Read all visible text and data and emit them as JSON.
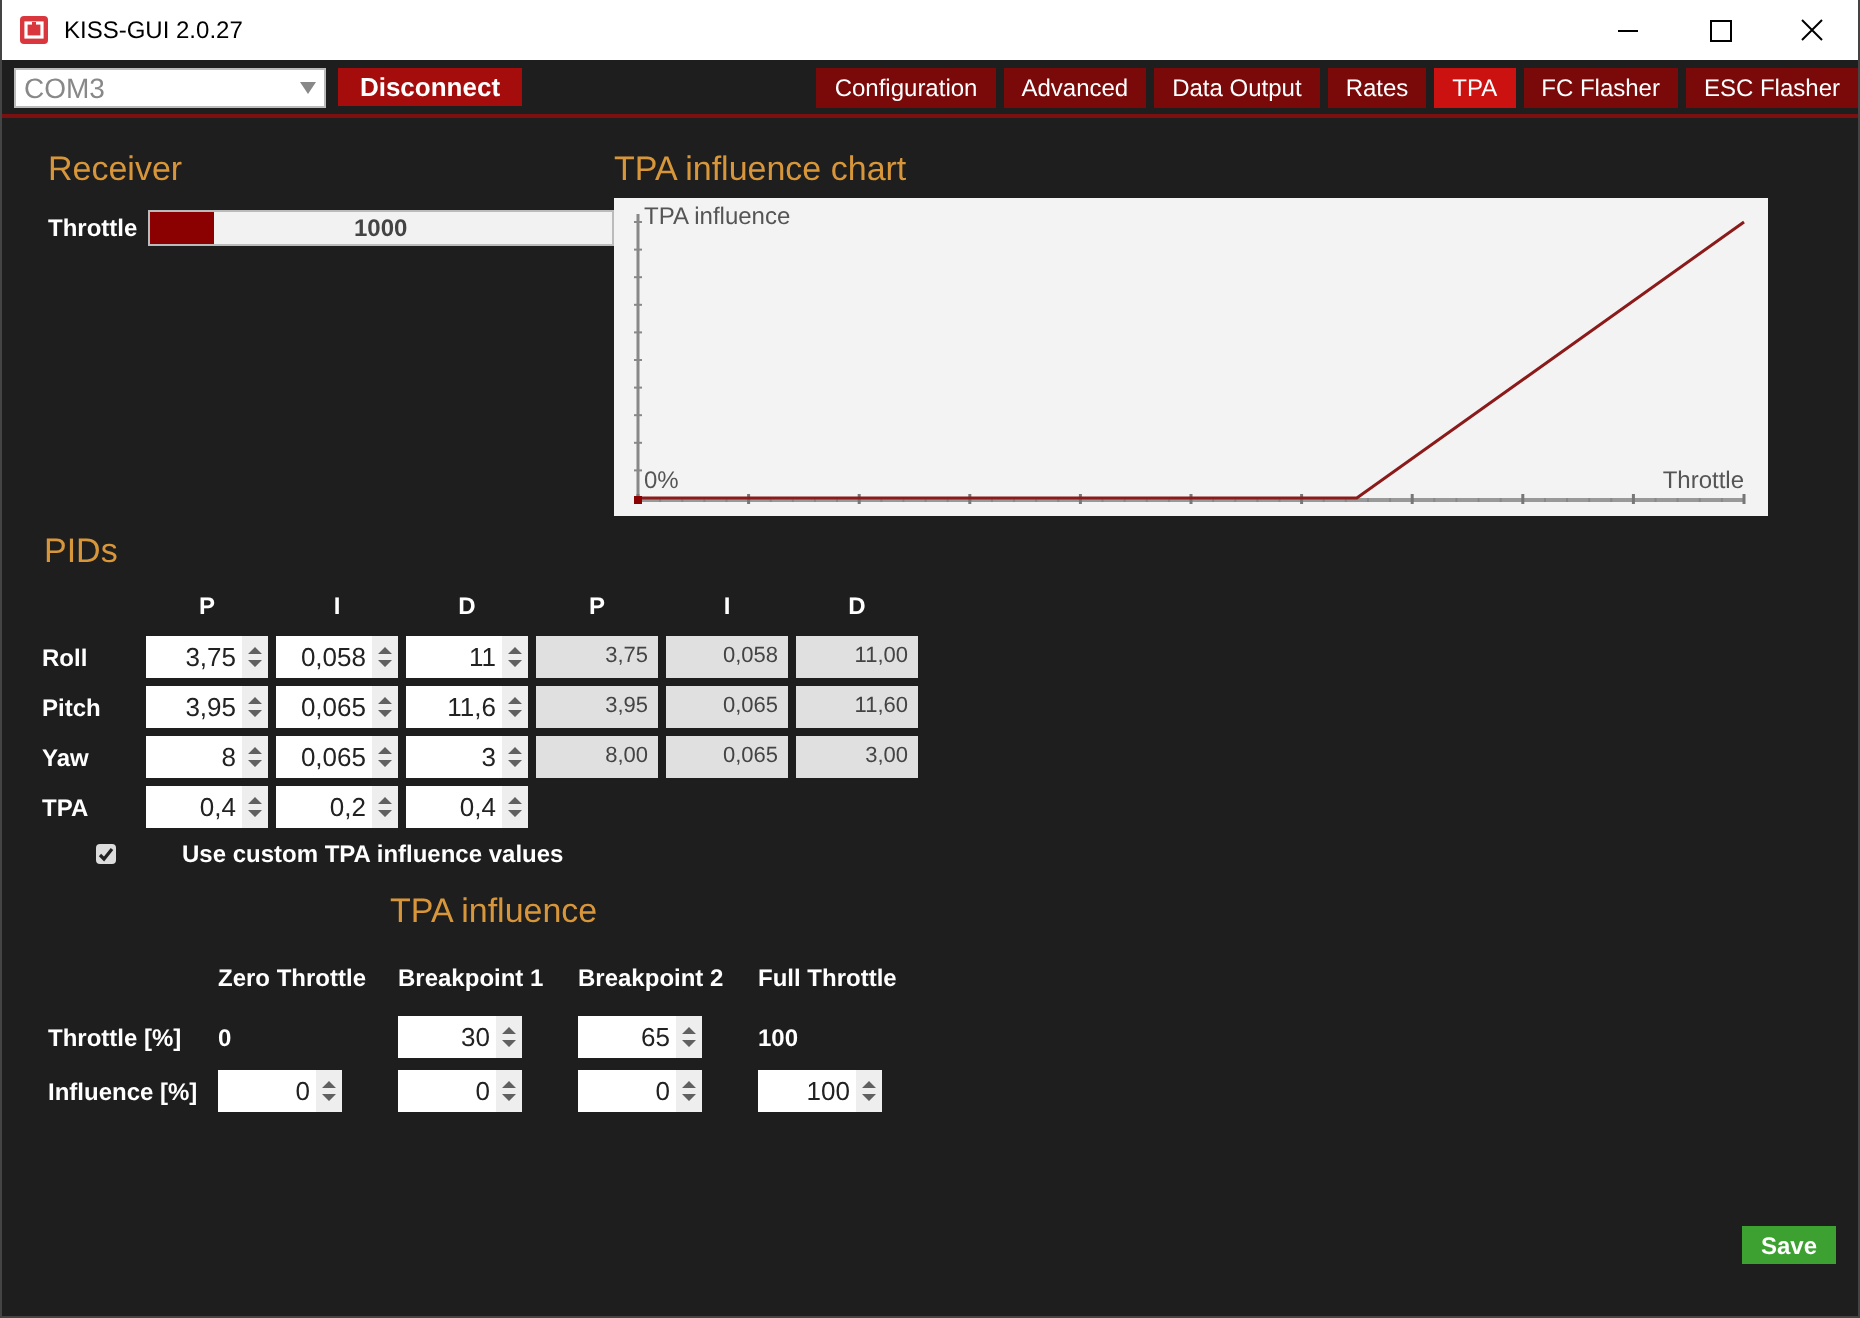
{
  "window": {
    "title": "KISS-GUI 2.0.27"
  },
  "port_select": {
    "value": "COM3"
  },
  "connect_button": "Disconnect",
  "tabs": [
    {
      "label": "Configuration",
      "selected": false
    },
    {
      "label": "Advanced",
      "selected": false
    },
    {
      "label": "Data Output",
      "selected": false
    },
    {
      "label": "Rates",
      "selected": false
    },
    {
      "label": "TPA",
      "selected": true
    },
    {
      "label": "FC Flasher",
      "selected": false
    },
    {
      "label": "ESC Flasher",
      "selected": false
    }
  ],
  "receiver": {
    "title": "Receiver",
    "channels": [
      {
        "label": "Throttle",
        "value": "1000",
        "level": 0.14
      }
    ]
  },
  "chart": {
    "title": "TPA influence chart",
    "ylabel": "TPA influence",
    "origin_label": "0%",
    "xlabel": "Throttle"
  },
  "pids": {
    "title": "PIDs",
    "columns": [
      "P",
      "I",
      "D",
      "P",
      "I",
      "D"
    ],
    "rows": [
      {
        "label": "Roll",
        "inputs": [
          "3,75",
          "0,058",
          "11"
        ],
        "rates": [
          "3,75",
          "0,058",
          "11,00"
        ]
      },
      {
        "label": "Pitch",
        "inputs": [
          "3,95",
          "0,065",
          "11,6"
        ],
        "rates": [
          "3,95",
          "0,065",
          "11,60"
        ]
      },
      {
        "label": "Yaw",
        "inputs": [
          "8",
          "0,065",
          "3"
        ],
        "rates": [
          "8,00",
          "0,065",
          "3,00"
        ]
      },
      {
        "label": "TPA",
        "inputs": [
          "0,4",
          "0,2",
          "0,4"
        ]
      }
    ]
  },
  "custom_tpa": {
    "checked": true,
    "label": "Use custom TPA influence values"
  },
  "tpa_influence": {
    "title": "TPA influence",
    "columns": [
      "Zero Throttle",
      "Breakpoint 1",
      "Breakpoint 2",
      "Full Throttle"
    ],
    "rows": [
      {
        "label": "Throttle [%]",
        "cells": [
          {
            "kind": "text",
            "value": "0"
          },
          {
            "kind": "input",
            "value": "30"
          },
          {
            "kind": "input",
            "value": "65"
          },
          {
            "kind": "text",
            "value": "100"
          }
        ]
      },
      {
        "label": "Influence [%]",
        "cells": [
          {
            "kind": "input",
            "value": "0"
          },
          {
            "kind": "input",
            "value": "0"
          },
          {
            "kind": "input",
            "value": "0"
          },
          {
            "kind": "input",
            "value": "100"
          }
        ]
      }
    ]
  },
  "save_button": "Save"
}
